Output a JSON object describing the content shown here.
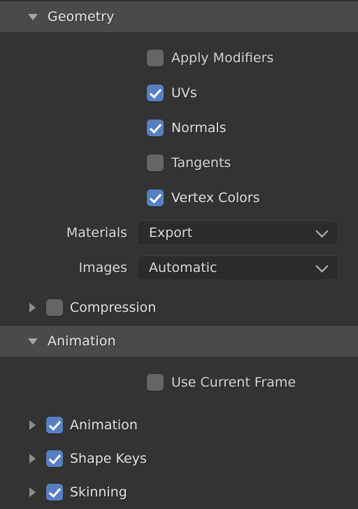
{
  "panel": {
    "colors": {
      "background": "#333333",
      "header_band": "#4a4a4a",
      "checkbox_on": "#5680c2",
      "checkbox_off": "#656565",
      "field_background": "#2b2b2b",
      "text": "#e2e2e2"
    }
  },
  "sections": [
    {
      "id": "geometry",
      "title": "Geometry",
      "expanded": true,
      "disclosure_icon": "triangle-down-icon",
      "checkboxes": [
        {
          "id": "apply-modifiers",
          "label": "Apply Modifiers",
          "checked": false
        },
        {
          "id": "uvs",
          "label": "UVs",
          "checked": true
        },
        {
          "id": "normals",
          "label": "Normals",
          "checked": true
        },
        {
          "id": "tangents",
          "label": "Tangents",
          "checked": false
        },
        {
          "id": "vertex-colors",
          "label": "Vertex Colors",
          "checked": true
        }
      ],
      "properties": [
        {
          "id": "materials",
          "label": "Materials",
          "value": "Export",
          "icon": "chevron-down-icon"
        },
        {
          "id": "images",
          "label": "Images",
          "value": "Automatic",
          "icon": "chevron-down-icon"
        }
      ],
      "subpanels": [
        {
          "id": "compression",
          "label": "Compression",
          "checked": false,
          "expanded": false,
          "disclosure_icon": "triangle-right-icon"
        }
      ]
    },
    {
      "id": "animation",
      "title": "Animation",
      "expanded": true,
      "disclosure_icon": "triangle-down-icon",
      "checkboxes": [
        {
          "id": "use-current-frame",
          "label": "Use Current Frame",
          "checked": false
        }
      ],
      "subpanels": [
        {
          "id": "animation-sub",
          "label": "Animation",
          "checked": true,
          "expanded": false,
          "disclosure_icon": "triangle-right-icon"
        },
        {
          "id": "shape-keys",
          "label": "Shape Keys",
          "checked": true,
          "expanded": false,
          "disclosure_icon": "triangle-right-icon"
        },
        {
          "id": "skinning",
          "label": "Skinning",
          "checked": true,
          "expanded": false,
          "disclosure_icon": "triangle-right-icon"
        }
      ]
    }
  ]
}
